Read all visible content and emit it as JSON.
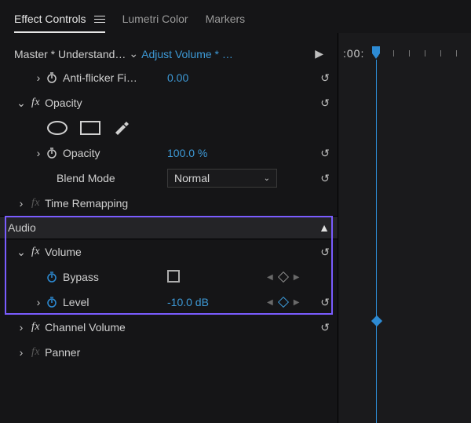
{
  "tabs": {
    "effect_controls": "Effect Controls",
    "lumetri": "Lumetri Color",
    "markers": "Markers"
  },
  "master": {
    "label": "Master * Understand…",
    "clip": "Adjust Volume * …"
  },
  "timecode": ":00:",
  "rows": {
    "anti_flicker": {
      "name": "Anti-flicker Fi…",
      "value": "0.00"
    },
    "opacity_group": "Opacity",
    "opacity": {
      "name": "Opacity",
      "value": "100.0 %"
    },
    "blend": {
      "name": "Blend Mode",
      "value": "Normal"
    },
    "time_remap": "Time Remapping"
  },
  "audio": {
    "header": "Audio",
    "volume": "Volume",
    "bypass": "Bypass",
    "level": {
      "name": "Level",
      "value": "-10.0 dB"
    },
    "channel_volume": "Channel Volume",
    "panner": "Panner"
  }
}
